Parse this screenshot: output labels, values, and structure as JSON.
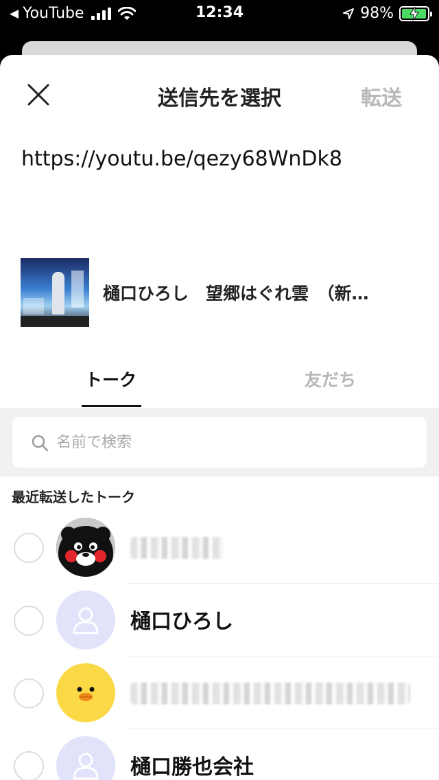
{
  "status_bar": {
    "back_app": "YouTube",
    "back_glyph": "◀",
    "time": "12:34",
    "battery": "98%",
    "battery_level": 0.98
  },
  "header": {
    "title": "送信先を選択",
    "forward_label": "転送",
    "close_icon": "close-icon"
  },
  "shared": {
    "url": "https://youtu.be/qezy68WnDk8",
    "preview_title": "樋口ひろし　望郷はぐれ雲　（新…"
  },
  "tabs": [
    {
      "label": "トーク",
      "active": true
    },
    {
      "label": "友だち",
      "active": false
    }
  ],
  "search": {
    "placeholder": "名前で検索",
    "value": ""
  },
  "recent": {
    "section_label": "最近転送したトーク",
    "items": [
      {
        "name": "",
        "avatar": "kumamon-avatar",
        "name_obscured": true
      },
      {
        "name": "樋口ひろし",
        "avatar": "default-person-avatar",
        "name_obscured": false
      },
      {
        "name": "",
        "avatar": "sally-chick-avatar",
        "name_obscured": true
      },
      {
        "name": "樋口勝也会社",
        "avatar": "default-person-avatar",
        "name_obscured": false
      }
    ]
  },
  "colors": {
    "accent_inactive": "#b8b8b8",
    "default_avatar_bg": "#e1e3fb",
    "sally_bg": "#fbd845",
    "battery_fill": "#4cd964",
    "search_bg": "#f1f1f3"
  }
}
